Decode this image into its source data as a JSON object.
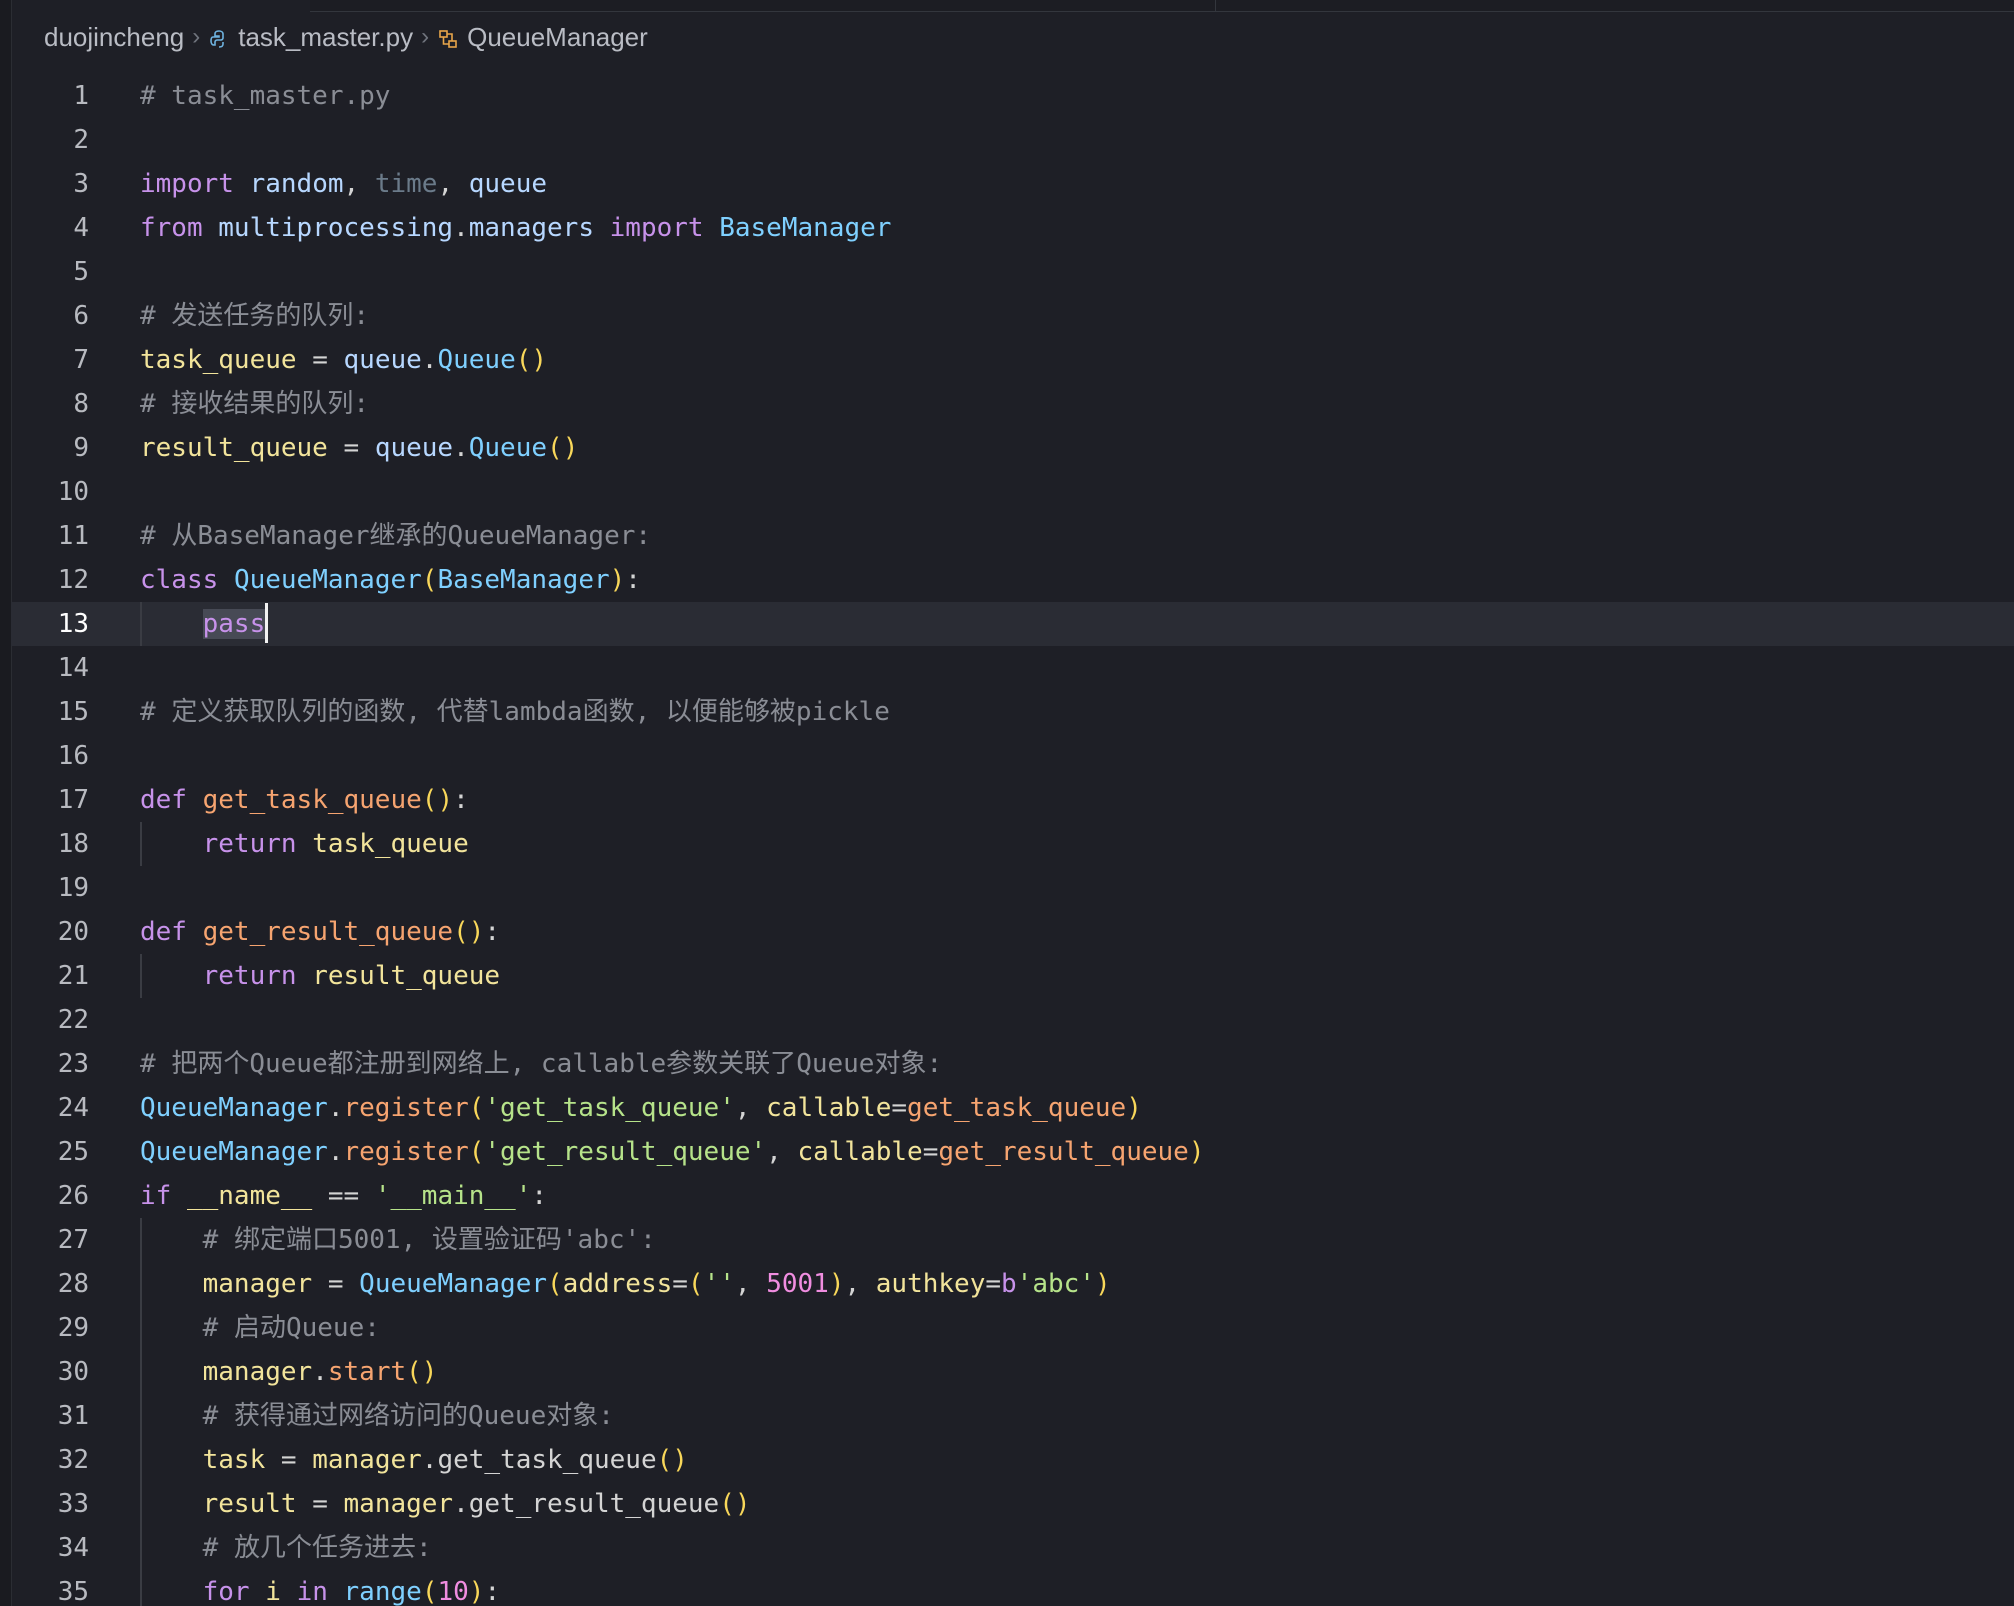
{
  "breadcrumb": {
    "folder": "duojincheng",
    "file": "task_master.py",
    "symbol": "QueueManager",
    "separator": ">"
  },
  "icons": {
    "file_icon": "python-file-icon",
    "symbol_icon": "class-symbol-icon"
  },
  "editor": {
    "current_line": 13,
    "lines": [
      {
        "n": "1",
        "text": "# task_master.py"
      },
      {
        "n": "2",
        "text": ""
      },
      {
        "n": "3",
        "text": "import random, time, queue"
      },
      {
        "n": "4",
        "text": "from multiprocessing.managers import BaseManager"
      },
      {
        "n": "5",
        "text": ""
      },
      {
        "n": "6",
        "text": "# 发送任务的队列:"
      },
      {
        "n": "7",
        "text": "task_queue = queue.Queue()"
      },
      {
        "n": "8",
        "text": "# 接收结果的队列:"
      },
      {
        "n": "9",
        "text": "result_queue = queue.Queue()"
      },
      {
        "n": "10",
        "text": ""
      },
      {
        "n": "11",
        "text": "# 从BaseManager继承的QueueManager:"
      },
      {
        "n": "12",
        "text": "class QueueManager(BaseManager):"
      },
      {
        "n": "13",
        "text": "    pass"
      },
      {
        "n": "14",
        "text": ""
      },
      {
        "n": "15",
        "text": "# 定义获取队列的函数, 代替lambda函数, 以便能够被pickle"
      },
      {
        "n": "16",
        "text": ""
      },
      {
        "n": "17",
        "text": "def get_task_queue():"
      },
      {
        "n": "18",
        "text": "    return task_queue"
      },
      {
        "n": "19",
        "text": ""
      },
      {
        "n": "20",
        "text": "def get_result_queue():"
      },
      {
        "n": "21",
        "text": "    return result_queue"
      },
      {
        "n": "22",
        "text": ""
      },
      {
        "n": "23",
        "text": "# 把两个Queue都注册到网络上, callable参数关联了Queue对象:"
      },
      {
        "n": "24",
        "text": "QueueManager.register('get_task_queue', callable=get_task_queue)"
      },
      {
        "n": "25",
        "text": "QueueManager.register('get_result_queue', callable=get_result_queue)"
      },
      {
        "n": "26",
        "text": "if __name__ == '__main__':"
      },
      {
        "n": "27",
        "text": "    # 绑定端口5001, 设置验证码'abc':"
      },
      {
        "n": "28",
        "text": "    manager = QueueManager(address=('', 5001), authkey=b'abc')"
      },
      {
        "n": "29",
        "text": "    # 启动Queue:"
      },
      {
        "n": "30",
        "text": "    manager.start()"
      },
      {
        "n": "31",
        "text": "    # 获得通过网络访问的Queue对象:"
      },
      {
        "n": "32",
        "text": "    task = manager.get_task_queue()"
      },
      {
        "n": "33",
        "text": "    result = manager.get_result_queue()"
      },
      {
        "n": "34",
        "text": "    # 放几个任务进去:"
      },
      {
        "n": "35",
        "text": "    for i in range(10):"
      }
    ]
  },
  "colors": {
    "background": "#1e1f26",
    "current_line": "#2a2c34",
    "comment": "#8a8d95",
    "keyword": "#c792ea",
    "class": "#7fd0ff",
    "variable": "#f2e49b",
    "function": "#f6a470",
    "string": "#b6e38a",
    "number": "#f08de0"
  }
}
